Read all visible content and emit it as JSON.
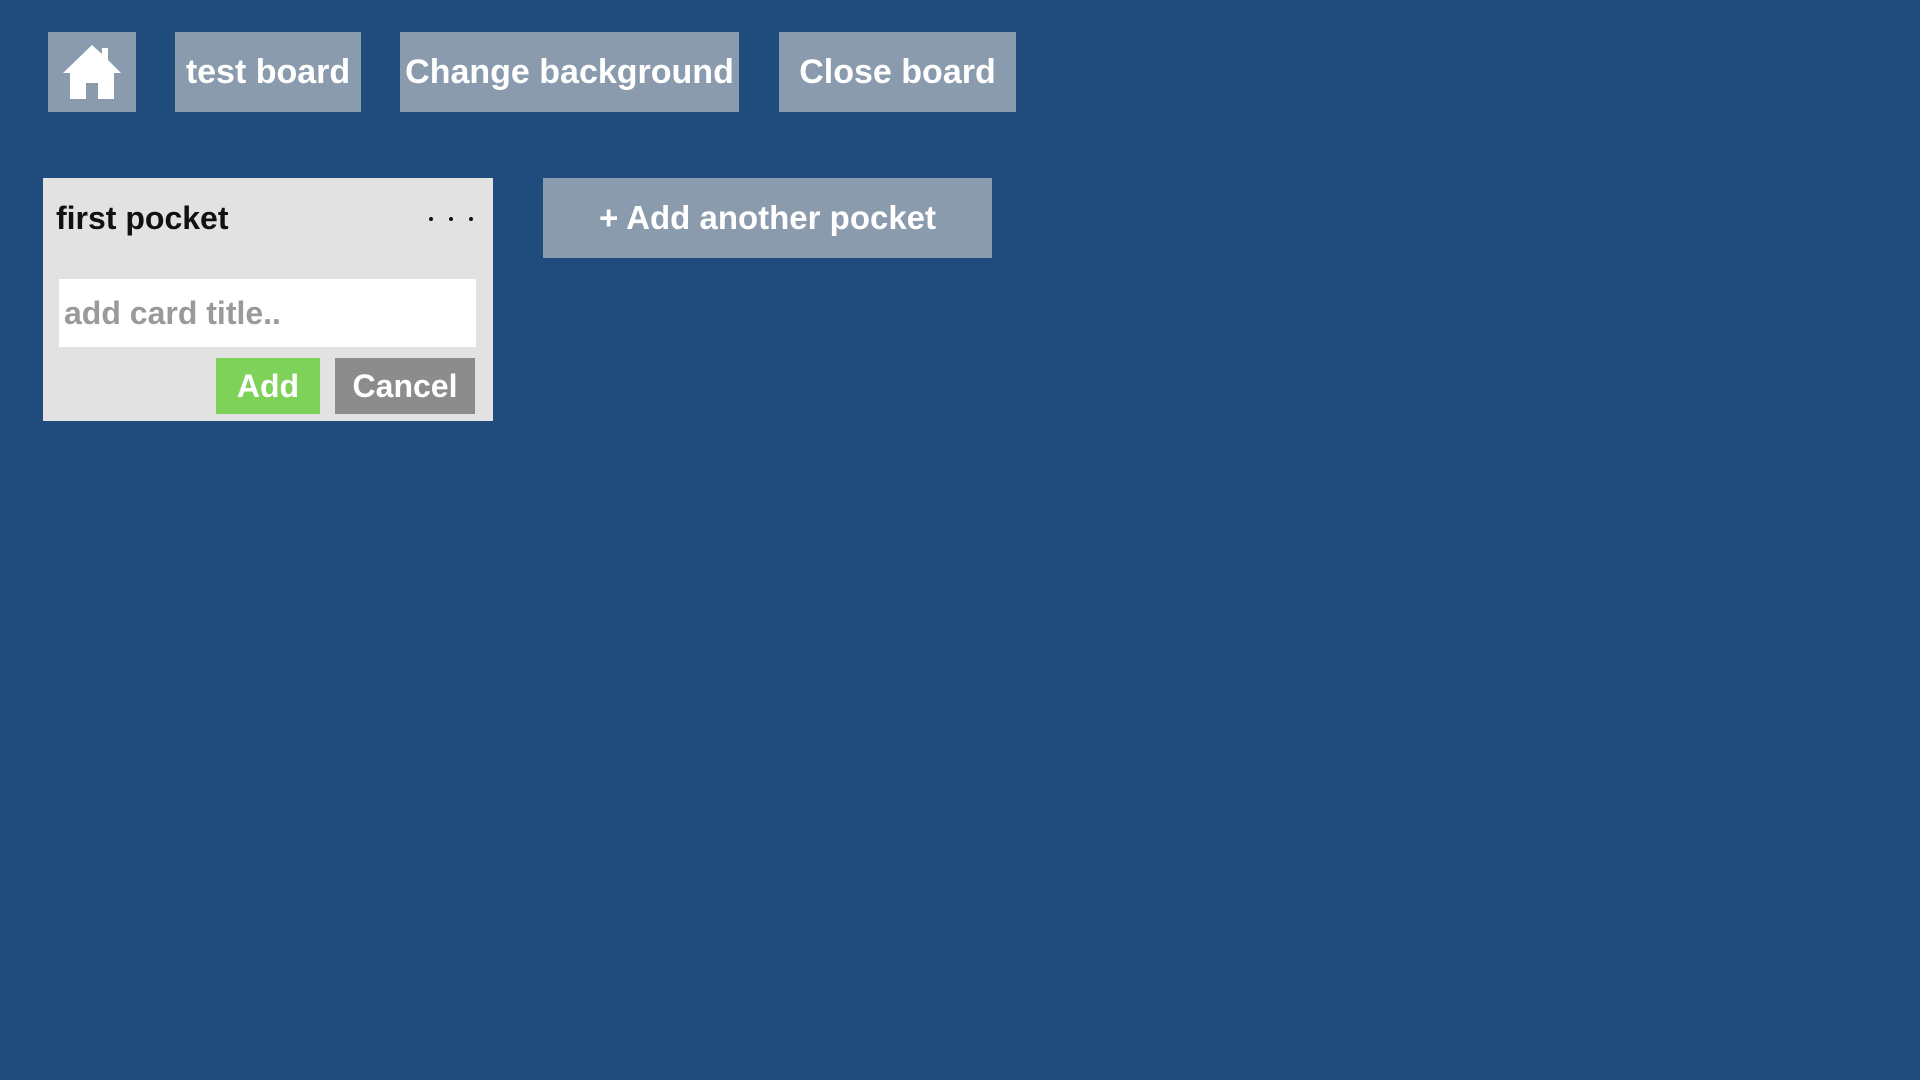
{
  "header": {
    "home_icon": "home-icon",
    "board_name": "test board",
    "change_background_label": "Change background",
    "close_board_label": "Close board"
  },
  "pockets": [
    {
      "title": "first pocket",
      "menu_icon": "more-horizontal-icon",
      "card_input": {
        "value": "",
        "placeholder": "add card title.."
      },
      "add_label": "Add",
      "cancel_label": "Cancel"
    }
  ],
  "add_pocket_label": "+ Add another pocket",
  "colors": {
    "background": "#1f4c7c",
    "toolbar_button": "#8a9bae",
    "pocket_background": "#e2e2e2",
    "add_button": "#7ed159",
    "cancel_button": "#8c8c8c"
  }
}
